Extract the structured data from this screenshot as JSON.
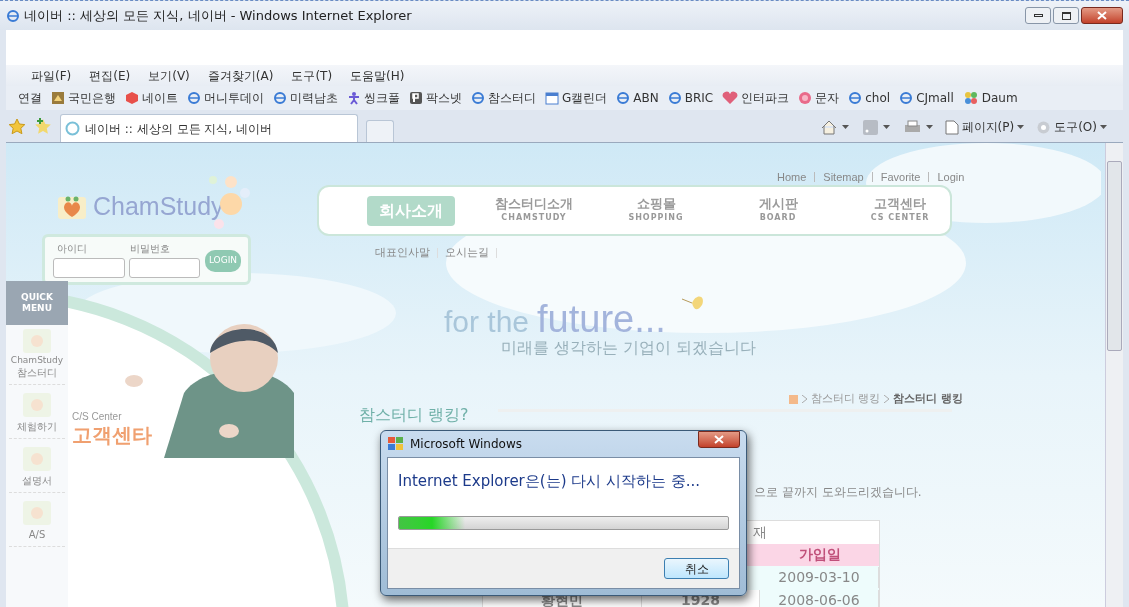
{
  "window": {
    "title": "네이버 :: 세상의 모든 지식, 네이버 - Windows Internet Explorer"
  },
  "menu": [
    "파일(F)",
    "편집(E)",
    "보기(V)",
    "즐겨찾기(A)",
    "도구(T)",
    "도움말(H)"
  ],
  "links": {
    "label": "연결",
    "items": [
      {
        "label": "국민은행",
        "kind": "bank"
      },
      {
        "label": "네이트",
        "kind": "cube"
      },
      {
        "label": "머니투데이",
        "kind": "ie"
      },
      {
        "label": "미력남초",
        "kind": "ie"
      },
      {
        "label": "씽크풀",
        "kind": "person"
      },
      {
        "label": "팍스넷",
        "kind": "p"
      },
      {
        "label": "참스터디",
        "kind": "ie"
      },
      {
        "label": "G캘린더",
        "kind": "calendar"
      },
      {
        "label": "ABN",
        "kind": "ie"
      },
      {
        "label": "BRIC",
        "kind": "ie"
      },
      {
        "label": "인터파크",
        "kind": "heart"
      },
      {
        "label": "문자",
        "kind": "circle"
      },
      {
        "label": "chol",
        "kind": "ie"
      },
      {
        "label": "CJmall",
        "kind": "ie"
      },
      {
        "label": "Daum",
        "kind": "flower"
      }
    ]
  },
  "tab": {
    "title": "네이버 :: 세상의 모든 지식, 네이버"
  },
  "command_bar": [
    "페이지(P)",
    "도구(O)"
  ],
  "page": {
    "top_links": [
      "Home",
      "Sitemap",
      "Favorite",
      "Login"
    ],
    "logo": "ChamStudy",
    "nav": [
      {
        "label": "회사소개",
        "selected": true
      },
      {
        "label": "참스터디소개",
        "sublabel": "CHAMSTUDY",
        "selected": false
      },
      {
        "label": "쇼핑몰",
        "sublabel": "SHOPPING",
        "selected": false
      },
      {
        "label": "게시판",
        "sublabel": "BOARD",
        "selected": false
      },
      {
        "label": "고객센타",
        "sublabel": "CS CENTER",
        "selected": false
      }
    ],
    "subnav": [
      "대표인사말",
      "오시는길"
    ],
    "login": {
      "id_label": "아이디",
      "pw_label": "비밀번호",
      "button": "LOGIN"
    },
    "quick_menu": {
      "title": "QUICK MENU",
      "items": [
        {
          "label": "참스터디",
          "caption": "ChamStudy"
        },
        {
          "label": "체험하기"
        },
        {
          "label": "설명서"
        },
        {
          "label": "A/S"
        }
      ]
    },
    "cs_center": {
      "en": "C/S Center",
      "ko": "고객센타"
    },
    "slogan": {
      "lead": "for the",
      "main": "future...",
      "sub": "미래를 생각하는 기업이 되겠습니다"
    },
    "section_title": "참스터디 랭킹?",
    "breadcrumb": [
      "참스터디 랭킹",
      "참스터디 랭킹"
    ],
    "body_text": "으로 끝까지 도와드리겠습니다.",
    "table": {
      "caption": "재",
      "header": "가입일",
      "rows": [
        {
          "column_3": "2009-03-10"
        },
        {
          "column_1": "황현민",
          "column_2": "1928",
          "column_3": "2008-06-06"
        }
      ]
    }
  },
  "dialog": {
    "title": "Microsoft Windows",
    "message": "Internet Explorer은(는) 다시 시작하는 중...",
    "level": 0.2,
    "button": "취소"
  }
}
